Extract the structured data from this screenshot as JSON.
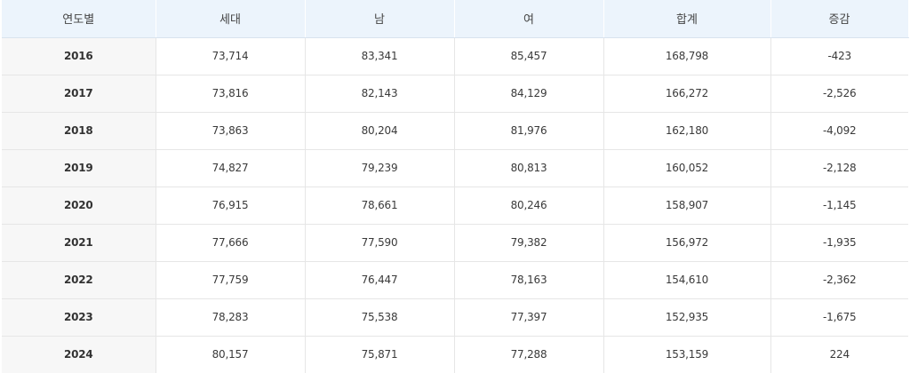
{
  "table": {
    "headers": [
      "연도별",
      "세대",
      "남",
      "여",
      "합계",
      "증감"
    ],
    "rows": [
      [
        "2016",
        "73,714",
        "83,341",
        "85,457",
        "168,798",
        "-423"
      ],
      [
        "2017",
        "73,816",
        "82,143",
        "84,129",
        "166,272",
        "-2,526"
      ],
      [
        "2018",
        "73,863",
        "80,204",
        "81,976",
        "162,180",
        "-4,092"
      ],
      [
        "2019",
        "74,827",
        "79,239",
        "80,813",
        "160,052",
        "-2,128"
      ],
      [
        "2020",
        "76,915",
        "78,661",
        "80,246",
        "158,907",
        "-1,145"
      ],
      [
        "2021",
        "77,666",
        "77,590",
        "79,382",
        "156,972",
        "-1,935"
      ],
      [
        "2022",
        "77,759",
        "76,447",
        "78,163",
        "154,610",
        "-2,362"
      ],
      [
        "2023",
        "78,283",
        "75,538",
        "77,397",
        "152,935",
        "-1,675"
      ],
      [
        "2024",
        "80,157",
        "75,871",
        "77,288",
        "153,159",
        "224"
      ]
    ]
  }
}
